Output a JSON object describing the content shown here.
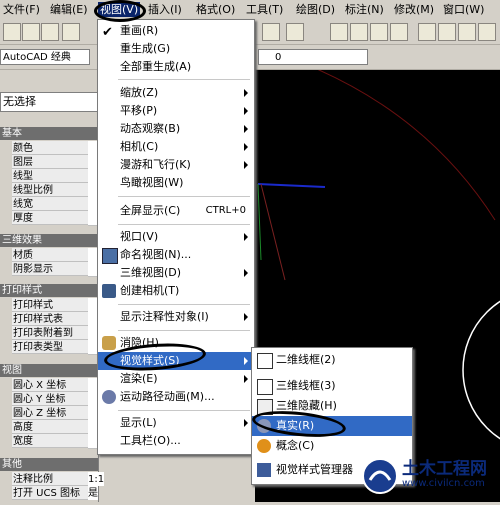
{
  "menubar": {
    "items": [
      "文件(F)",
      "编辑(E)",
      "视图(V)",
      "插入(I)",
      "格式(O)",
      "工具(T)",
      "绘图(D)",
      "标注(N)",
      "修改(M)",
      "窗口(W)"
    ]
  },
  "toolbar": {
    "workspace_label": "AutoCAD 经典",
    "layer_value": "0"
  },
  "properties": {
    "selection": "无选择",
    "groups": [
      {
        "title": "基本",
        "rows": [
          "颜色",
          "图层",
          "线型",
          "线型比例",
          "线宽",
          "厚度"
        ]
      },
      {
        "title": "三维效果",
        "rows": [
          "材质",
          "阴影显示"
        ]
      },
      {
        "title": "打印样式",
        "rows": [
          "打印样式",
          "打印样式表",
          "打印表附着到",
          "打印表类型"
        ]
      },
      {
        "title": "视图",
        "rows": [
          "圆心 X 坐标",
          "圆心 Y 坐标",
          "圆心 Z 坐标",
          "高度",
          "宽度"
        ]
      },
      {
        "title": "其他",
        "rows": [
          "注释比例",
          "打开 UCS 图标"
        ]
      }
    ],
    "values": {
      "annotation_scale": "1:1",
      "ucs_icon_on": "是"
    }
  },
  "view_menu": {
    "items": [
      {
        "label": "重画(R)",
        "shortcut": "",
        "submenu": false
      },
      {
        "label": "重生成(G)",
        "shortcut": "",
        "submenu": false
      },
      {
        "label": "全部重生成(A)",
        "shortcut": "",
        "submenu": false
      },
      {
        "label": "缩放(Z)",
        "shortcut": "",
        "submenu": true
      },
      {
        "label": "平移(P)",
        "shortcut": "",
        "submenu": true
      },
      {
        "label": "动态观察(B)",
        "shortcut": "",
        "submenu": true
      },
      {
        "label": "相机(C)",
        "shortcut": "",
        "submenu": true
      },
      {
        "label": "漫游和飞行(K)",
        "shortcut": "",
        "submenu": true
      },
      {
        "label": "鸟瞰视图(W)",
        "shortcut": "",
        "submenu": false
      },
      {
        "label": "全屏显示(C)",
        "shortcut": "CTRL+0",
        "submenu": false
      },
      {
        "label": "视口(V)",
        "shortcut": "",
        "submenu": true
      },
      {
        "label": "命名视图(N)...",
        "shortcut": "",
        "submenu": false
      },
      {
        "label": "三维视图(D)",
        "shortcut": "",
        "submenu": true
      },
      {
        "label": "创建相机(T)",
        "shortcut": "",
        "submenu": false
      },
      {
        "label": "显示注释性对象(I)",
        "shortcut": "",
        "submenu": true
      },
      {
        "label": "消隐(H)",
        "shortcut": "",
        "submenu": false
      },
      {
        "label": "视觉样式(S)",
        "shortcut": "",
        "submenu": true
      },
      {
        "label": "渲染(E)",
        "shortcut": "",
        "submenu": true
      },
      {
        "label": "运动路径动画(M)...",
        "shortcut": "",
        "submenu": false
      },
      {
        "label": "显示(L)",
        "shortcut": "",
        "submenu": true
      },
      {
        "label": "工具栏(O)...",
        "shortcut": "",
        "submenu": false
      }
    ]
  },
  "visual_style_submenu": {
    "items": [
      "二维线框(2)",
      "三维线框(3)",
      "三维隐藏(H)",
      "真实(R)",
      "概念(C)",
      "视觉样式管理器"
    ]
  },
  "watermark": {
    "title": "土木工程网",
    "url": "www.civilcn.com"
  },
  "colors": {
    "menu_highlight": "#316ac5",
    "menubar_highlight": "#0a246a",
    "panel_bg": "#d4d0c8",
    "canvas_bg": "#000000"
  }
}
